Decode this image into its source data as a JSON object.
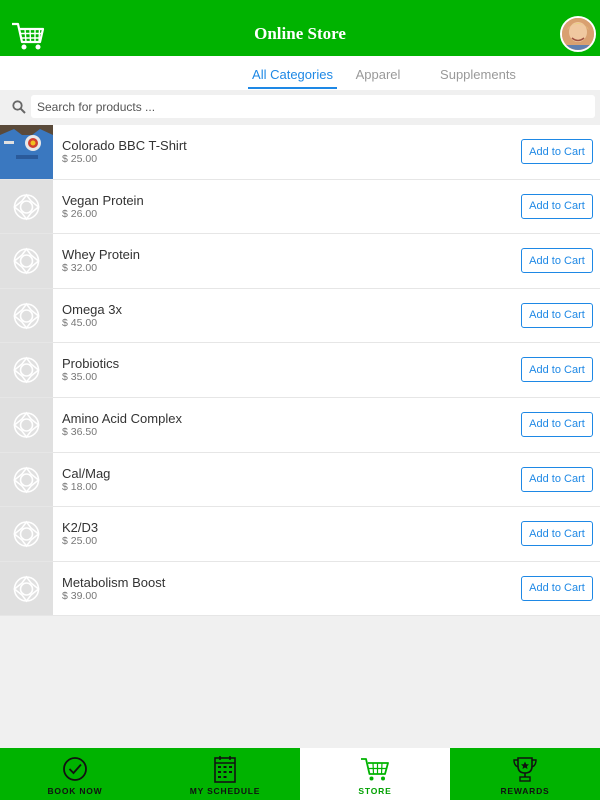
{
  "header": {
    "title": "Online Store"
  },
  "tabs": [
    {
      "label": "All Categories",
      "active": true
    },
    {
      "label": "Apparel",
      "active": false
    },
    {
      "label": "Supplements",
      "active": false
    }
  ],
  "search": {
    "placeholder": "Search for products ...",
    "value": ""
  },
  "products": [
    {
      "name": "Colorado BBC T-Shirt",
      "price": "$ 25.00",
      "button": "Add to Cart",
      "image": "tshirt-photo"
    },
    {
      "name": "Vegan Protein",
      "price": "$ 26.00",
      "button": "Add to Cart",
      "image": "placeholder-logo"
    },
    {
      "name": "Whey Protein",
      "price": "$ 32.00",
      "button": "Add to Cart",
      "image": "placeholder-logo"
    },
    {
      "name": "Omega 3x",
      "price": "$ 45.00",
      "button": "Add to Cart",
      "image": "placeholder-logo"
    },
    {
      "name": "Probiotics",
      "price": "$ 35.00",
      "button": "Add to Cart",
      "image": "placeholder-logo"
    },
    {
      "name": "Amino Acid Complex",
      "price": "$ 36.50",
      "button": "Add to Cart",
      "image": "placeholder-logo"
    },
    {
      "name": "Cal/Mag",
      "price": "$ 18.00",
      "button": "Add to Cart",
      "image": "placeholder-logo"
    },
    {
      "name": "K2/D3",
      "price": "$ 25.00",
      "button": "Add to Cart",
      "image": "placeholder-logo"
    },
    {
      "name": "Metabolism Boost",
      "price": "$ 39.00",
      "button": "Add to Cart",
      "image": "placeholder-logo"
    }
  ],
  "bottom_nav": [
    {
      "label": "BOOK NOW",
      "icon": "check-circle-icon",
      "active": false
    },
    {
      "label": "MY SCHEDULE",
      "icon": "calendar-icon",
      "active": false
    },
    {
      "label": "STORE",
      "icon": "cart-icon",
      "active": true
    },
    {
      "label": "REWARDS",
      "icon": "trophy-icon",
      "active": false
    }
  ],
  "colors": {
    "brand_green": "#00b300",
    "accent_blue": "#1e88e5",
    "background": "#f0f0f0"
  }
}
